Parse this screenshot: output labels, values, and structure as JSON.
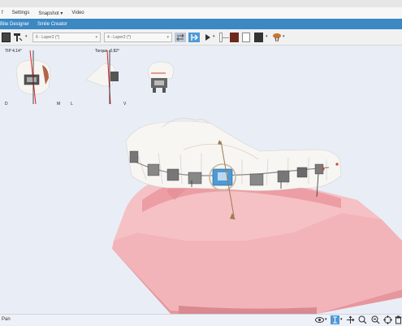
{
  "menu": {
    "items": [
      "f",
      "Settings",
      "Snapshot",
      "Video"
    ],
    "snapshot_caret": "▾"
  },
  "tabs": [
    {
      "label": "Bite Designer"
    },
    {
      "label": "Smile Creator"
    }
  ],
  "toolbar": {
    "dropdown_left": "6 - Layer2 (*)",
    "dropdown_right": "4 - Layer2 (*)",
    "play_icon": "play-icon",
    "icons": [
      "square-icon",
      "tooth-tool-icon",
      "rewind-icon",
      "swap-icon",
      "play-icon",
      "playback-slider",
      "film-icon",
      "page-icon",
      "film-strip-icon",
      "teeth-view-icon"
    ]
  },
  "inset": {
    "tip_label": "TIP 4.14°",
    "torque_label": "Torque -0.82°",
    "axis_labels": [
      "D",
      "M",
      "L",
      "V"
    ]
  },
  "status": {
    "text": "Pan"
  },
  "status_icons": [
    "eye-icon",
    "rotate-icon",
    "pan-icon",
    "zoom-in-icon",
    "zoom-out-icon",
    "target-icon",
    "trash-icon"
  ],
  "colors": {
    "accent": "#3b88c3",
    "gum": "#f0a9ae",
    "highlight": "#4d9ad6"
  }
}
